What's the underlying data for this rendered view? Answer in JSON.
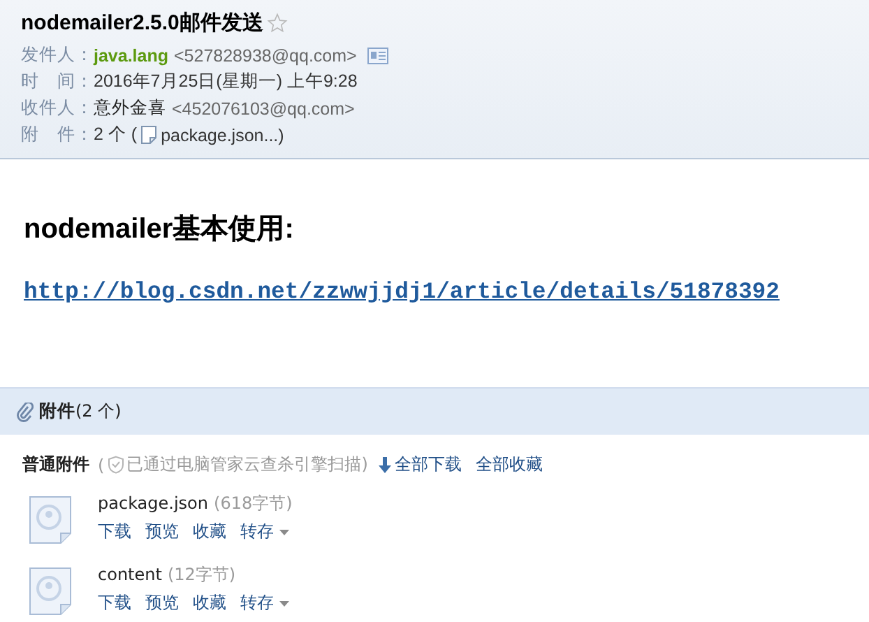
{
  "header": {
    "subject": "nodemailer2.5.0邮件发送",
    "starred": false,
    "sender": {
      "label": "发件人：",
      "name": "java.lang",
      "address": "<527828938@qq.com>"
    },
    "time": {
      "label": "时　间：",
      "value": "2016年7月25日(星期一) 上午9:28"
    },
    "recipient": {
      "label": "收件人：",
      "name": "意外金喜",
      "address": "<452076103@qq.com>"
    },
    "attachments": {
      "label": "附　件：",
      "count": "2 个 (",
      "file": "package.json...)"
    }
  },
  "body": {
    "heading": "nodemailer基本使用:",
    "link": "http://blog.csdn.net/zzwwjjdj1/article/details/51878392"
  },
  "attachment_panel": {
    "title": "附件",
    "count": "(2 个)",
    "group_label": "普通附件",
    "scan_open": "(",
    "scan_note": "已通过电脑管家云查杀引擎扫描)",
    "download_all": "全部下载",
    "save_all": "全部收藏",
    "files": [
      {
        "name": "package.json",
        "size": "(618字节)",
        "actions": [
          {
            "label": "下载",
            "dropdown": false
          },
          {
            "label": "预览",
            "dropdown": false
          },
          {
            "label": "收藏",
            "dropdown": false
          },
          {
            "label": "转存",
            "dropdown": true
          }
        ]
      },
      {
        "name": "content",
        "size": "(12字节)",
        "actions": [
          {
            "label": "下载",
            "dropdown": false
          },
          {
            "label": "预览",
            "dropdown": false
          },
          {
            "label": "收藏",
            "dropdown": false
          },
          {
            "label": "转存",
            "dropdown": true
          }
        ]
      }
    ]
  }
}
